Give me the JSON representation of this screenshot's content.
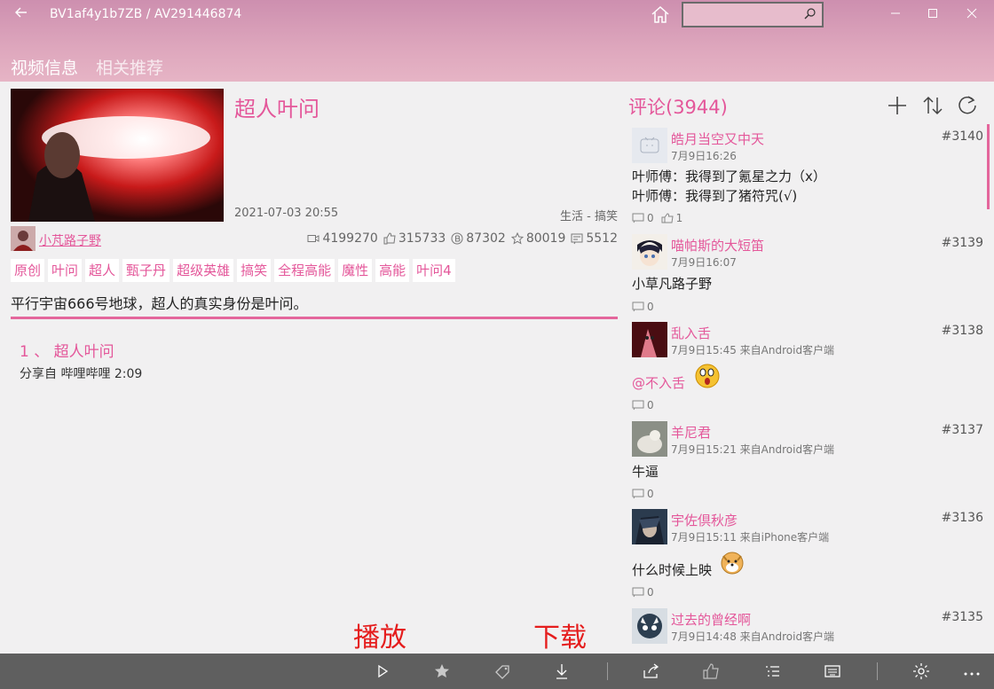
{
  "window": {
    "title": "BV1af4y1b7ZB / AV291446874"
  },
  "search": {
    "placeholder": ""
  },
  "pivot": {
    "tabs": [
      "视频信息",
      "相关推荐"
    ]
  },
  "video": {
    "title": "超人叶问",
    "date": "2021-07-03 20:55",
    "category": "生活 - 搞笑",
    "uploader": "小芃路子野",
    "stats": {
      "views": "4199270",
      "likes": "315733",
      "coins": "87302",
      "favorites": "80019",
      "danmaku": "5512"
    },
    "tags": [
      "原创",
      "叶问",
      "超人",
      "甄子丹",
      "超级英雄",
      "搞笑",
      "全程高能",
      "魔性",
      "高能",
      "叶问4"
    ],
    "description": "平行宇宙666号地球，超人的真实身份是叶问。",
    "parts": [
      {
        "title": "1 、 超人叶问",
        "sub": "分享自 哔哩哔哩 2:09"
      }
    ]
  },
  "overlay": {
    "play": "播放",
    "download": "下载"
  },
  "comments": {
    "title": "评论(3944)",
    "items": [
      {
        "name": "皓月当空又中天",
        "floor": "#3140",
        "meta": "7月9日16:26",
        "lines": [
          "叶师傅：我得到了氪星之力（x）",
          "叶师傅：我得到了猪符咒(√)"
        ],
        "replies": "0",
        "likes": "1"
      },
      {
        "name": "喵帕斯的大短笛",
        "floor": "#3139",
        "meta": "7月9日16:07",
        "lines": [
          "小草凡路子野"
        ],
        "replies": "0",
        "likes": ""
      },
      {
        "name": "乱入舌",
        "floor": "#3138",
        "meta": "7月9日15:45 来自Android客户端",
        "lines": [
          "@不入舌"
        ],
        "replies": "0",
        "likes": ""
      },
      {
        "name": "羊尼君",
        "floor": "#3137",
        "meta": "7月9日15:21 来自Android客户端",
        "lines": [
          "牛逼"
        ],
        "replies": "0",
        "likes": ""
      },
      {
        "name": "宇佐倶秋彦",
        "floor": "#3136",
        "meta": "7月9日15:11 来自iPhone客户端",
        "lines": [
          "什么时候上映"
        ],
        "replies": "0",
        "likes": ""
      },
      {
        "name": "过去的曾经啊",
        "floor": "#3135",
        "meta": "7月9日14:48 来自Android客户端",
        "lines": [],
        "replies": "",
        "likes": ""
      }
    ]
  },
  "colors": {
    "accent": "#e4579a",
    "header": "#cd8faf",
    "cmdbar": "#5f5f5f"
  }
}
